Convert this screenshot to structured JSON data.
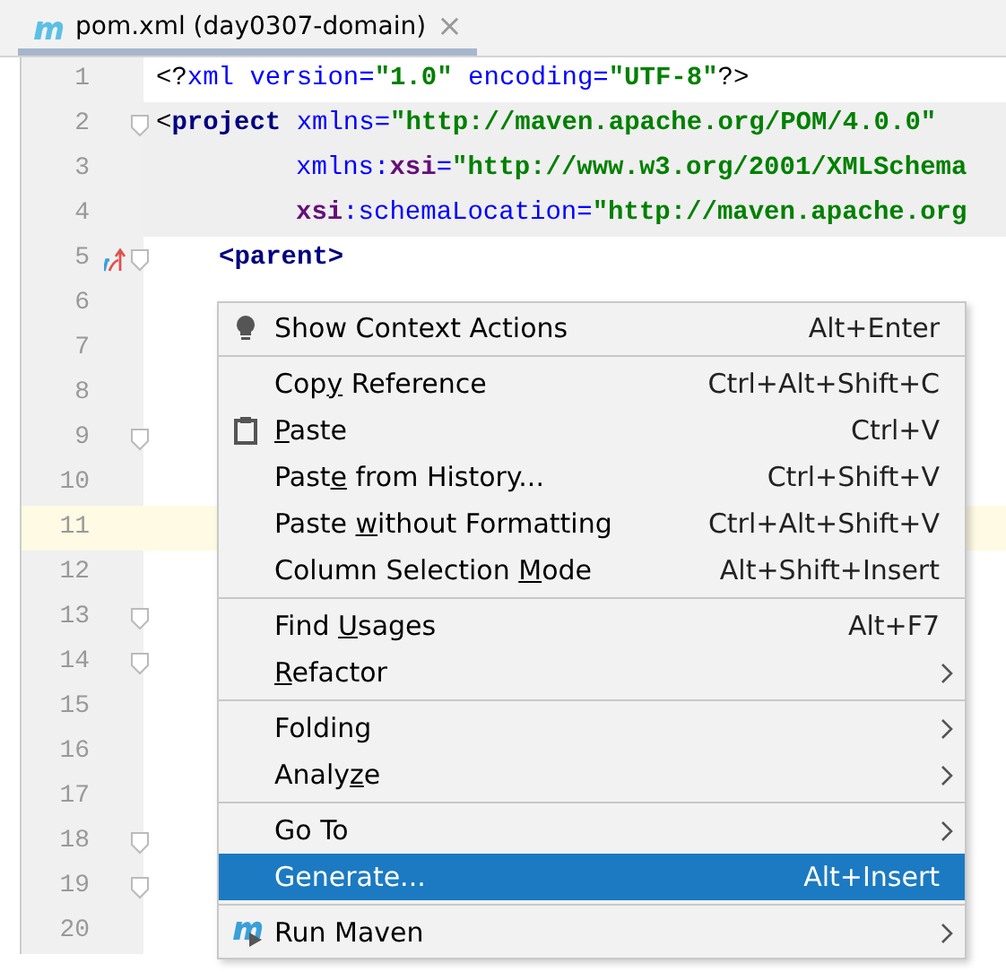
{
  "tab": {
    "title": "pom.xml (day0307-domain)",
    "close": "×",
    "selected": true
  },
  "editor": {
    "lines": [
      {
        "number": "1",
        "kind": "top",
        "shaded": false,
        "current": false,
        "fold": false,
        "tokens": [
          {
            "kind": "pi",
            "text": "<?"
          },
          {
            "kind": "attr",
            "text": "xml version="
          },
          {
            "kind": "value",
            "text": "\"1.0\""
          },
          {
            "kind": "attr",
            "text": " encoding="
          },
          {
            "kind": "value",
            "text": "\"UTF-8\""
          },
          {
            "kind": "pi",
            "text": "?>"
          }
        ]
      },
      {
        "number": "2",
        "kind": "top",
        "shaded": true,
        "current": false,
        "fold": true,
        "tokens": [
          {
            "kind": "pi",
            "text": "<"
          },
          {
            "kind": "tag",
            "text": "project "
          },
          {
            "kind": "attr",
            "text": "xmlns="
          },
          {
            "kind": "value",
            "text": "\"http://maven.apache.org/POM/4.0.0\""
          }
        ]
      },
      {
        "number": "3",
        "kind": "continuation",
        "shaded": true,
        "current": false,
        "fold": false,
        "tokens": [
          {
            "kind": "attr",
            "text": "xmlns:"
          },
          {
            "kind": "ns",
            "text": "xsi"
          },
          {
            "kind": "attr",
            "text": "="
          },
          {
            "kind": "value",
            "text": "\"http://www.w3.org/2001/XMLSchema"
          }
        ]
      },
      {
        "number": "4",
        "kind": "continuation",
        "shaded": true,
        "current": false,
        "fold": false,
        "tokens": [
          {
            "kind": "ns",
            "text": "xsi"
          },
          {
            "kind": "attr",
            "text": ":schemaLocation="
          },
          {
            "kind": "value",
            "text": "\"http://maven.apache.org"
          }
        ]
      },
      {
        "number": "5",
        "kind": "child",
        "shaded": false,
        "current": false,
        "fold": true,
        "override": true,
        "tokens": [
          {
            "kind": "tag",
            "text": "<parent>"
          }
        ]
      },
      {
        "number": "6",
        "shaded": false,
        "current": false,
        "fold": false
      },
      {
        "number": "7",
        "shaded": false,
        "current": false,
        "fold": false
      },
      {
        "number": "8",
        "shaded": false,
        "current": false,
        "fold": false
      },
      {
        "number": "9",
        "shaded": false,
        "current": false,
        "fold": true
      },
      {
        "number": "10",
        "shaded": false,
        "current": false,
        "fold": false
      },
      {
        "number": "11",
        "shaded": false,
        "current": true,
        "fold": false
      },
      {
        "number": "12",
        "shaded": false,
        "current": false,
        "fold": false
      },
      {
        "number": "13",
        "shaded": false,
        "current": false,
        "fold": true
      },
      {
        "number": "14",
        "shaded": false,
        "current": false,
        "fold": true
      },
      {
        "number": "15",
        "shaded": false,
        "current": false,
        "fold": false
      },
      {
        "number": "16",
        "shaded": false,
        "current": false,
        "fold": false
      },
      {
        "number": "17",
        "shaded": false,
        "current": false,
        "fold": false
      },
      {
        "number": "18",
        "shaded": false,
        "current": false,
        "fold": true
      },
      {
        "number": "19",
        "shaded": false,
        "current": false,
        "fold": true
      },
      {
        "number": "20",
        "shaded": false,
        "current": false,
        "fold": false
      }
    ]
  },
  "context_menu": {
    "items": [
      {
        "kind": "item",
        "before": "Show Context Actions",
        "shortcut": "Alt+Enter",
        "submenu": false,
        "selected": false
      },
      {
        "kind": "separator"
      },
      {
        "kind": "item",
        "before": "Cop",
        "mnemonic": "y",
        "after": " Reference",
        "shortcut": "Ctrl+Alt+Shift+C",
        "submenu": false,
        "selected": false
      },
      {
        "kind": "item",
        "mnemonic": "P",
        "after": "aste",
        "shortcut": "Ctrl+V",
        "submenu": false,
        "selected": false
      },
      {
        "kind": "item",
        "before": "Past",
        "mnemonic": "e",
        "after": " from History...",
        "shortcut": "Ctrl+Shift+V",
        "submenu": false,
        "selected": false
      },
      {
        "kind": "item",
        "before": "Paste ",
        "mnemonic": "w",
        "after": "ithout Formatting",
        "shortcut": "Ctrl+Alt+Shift+V",
        "submenu": false,
        "selected": false
      },
      {
        "kind": "item",
        "before": "Column Selection ",
        "mnemonic": "M",
        "after": "ode",
        "shortcut": "Alt+Shift+Insert",
        "submenu": false,
        "selected": false
      },
      {
        "kind": "separator"
      },
      {
        "kind": "item",
        "before": "Find ",
        "mnemonic": "U",
        "after": "sages",
        "shortcut": "Alt+F7",
        "submenu": false,
        "selected": false
      },
      {
        "kind": "item",
        "mnemonic": "R",
        "after": "efactor",
        "submenu": true,
        "selected": false
      },
      {
        "kind": "separator"
      },
      {
        "kind": "item",
        "before": "Folding",
        "submenu": true,
        "selected": false
      },
      {
        "kind": "item",
        "before": "Analy",
        "mnemonic": "z",
        "after": "e",
        "submenu": true,
        "selected": false
      },
      {
        "kind": "separator"
      },
      {
        "kind": "item",
        "before": "Go To",
        "submenu": true,
        "selected": false
      },
      {
        "kind": "item",
        "before": "Generate...",
        "shortcut": "Alt+Insert",
        "submenu": false,
        "selected": true
      },
      {
        "kind": "separator"
      },
      {
        "kind": "item",
        "before": "Run Maven",
        "submenu": true,
        "selected": false
      }
    ]
  }
}
